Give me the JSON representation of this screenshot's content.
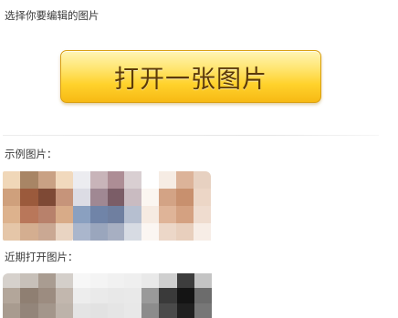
{
  "header": {
    "prompt": "选择你要编辑的图片"
  },
  "open_button": {
    "label": "打开一张图片"
  },
  "sample_section": {
    "title": "示例图片：",
    "thumbnails": [
      {
        "name": "sample-thumbnail-1",
        "grid": [
          4,
          4
        ],
        "colors": [
          "#f0d7b8",
          "#a88565",
          "#c9a184",
          "#f1d9bd",
          "#cfa07c",
          "#9b5a3c",
          "#7e4935",
          "#c6947a",
          "#ddb28d",
          "#b9775a",
          "#b8816b",
          "#d8ab88",
          "#e5c6a8",
          "#d4ae90",
          "#caa893",
          "#e9d4c2"
        ]
      },
      {
        "name": "sample-thumbnail-2",
        "grid": [
          4,
          4
        ],
        "colors": [
          "#ececf0",
          "#c8b4b9",
          "#ad8d95",
          "#d9cfd2",
          "#dcdce4",
          "#a08893",
          "#7b5d67",
          "#c9bbc1",
          "#8aa0c0",
          "#7084a8",
          "#6f7fa0",
          "#b6bfd0",
          "#aab6cc",
          "#9aa6bd",
          "#a7afc2",
          "#d7dbe3"
        ]
      },
      {
        "name": "sample-thumbnail-3",
        "grid": [
          4,
          4
        ],
        "colors": [
          "#ffffff",
          "#f6ece4",
          "#dcb399",
          "#e7d1c1",
          "#fbf6f1",
          "#d3a385",
          "#c8906e",
          "#ecd6c6",
          "#f6ebe2",
          "#dfb498",
          "#d4a181",
          "#efdccf",
          "#fbf6f2",
          "#ecd7c8",
          "#e8cfbd",
          "#f7ede6"
        ]
      }
    ]
  },
  "recent_section": {
    "title": "近期打开图片：",
    "thumbnails": [
      {
        "name": "recent-thumbnail-1",
        "grid": [
          4,
          3
        ],
        "colors": [
          "#d6d1cc",
          "#c7c0b9",
          "#a99c91",
          "#d4cfca",
          "#b3a69a",
          "#8f7f72",
          "#9c8c80",
          "#c2b7ae",
          "#a89b8f",
          "#93857a",
          "#a3968b",
          "#bdb3aa"
        ]
      },
      {
        "name": "recent-thumbnail-2",
        "grid": [
          4,
          3
        ],
        "colors": [
          "#f7f7f7",
          "#f4f4f4",
          "#f1f1f1",
          "#efefef",
          "#ededed",
          "#eaeaea",
          "#e8e8e8",
          "#e9e9e9",
          "#e4e4e4",
          "#e2e2e2",
          "#e5e5e5",
          "#e8e8e8"
        ]
      },
      {
        "name": "recent-thumbnail-3",
        "grid": [
          4,
          3
        ],
        "colors": [
          "#e9e9e9",
          "#cfcfcf",
          "#3d3d3d",
          "#c4c4c4",
          "#9a9a9a",
          "#3a3a3a",
          "#141414",
          "#6c6c6c",
          "#8c8c8c",
          "#4a4a4a",
          "#202020",
          "#777777"
        ]
      }
    ]
  }
}
